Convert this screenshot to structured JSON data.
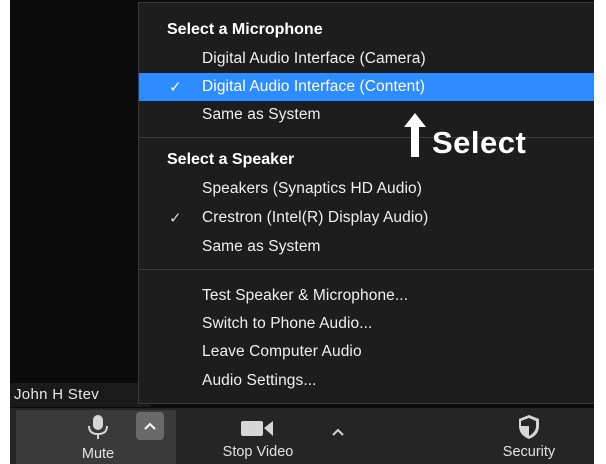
{
  "participant": {
    "name": "John H Stev"
  },
  "menu": {
    "microphone": {
      "title": "Select a Microphone",
      "items": [
        {
          "label": "Digital Audio Interface (Camera)",
          "checked": false,
          "selected": false
        },
        {
          "label": "Digital Audio Interface (Content)",
          "checked": true,
          "selected": true
        },
        {
          "label": "Same as System",
          "checked": false,
          "selected": false
        }
      ]
    },
    "speaker": {
      "title": "Select a Speaker",
      "items": [
        {
          "label": "Speakers (Synaptics HD Audio)",
          "checked": false
        },
        {
          "label": "Crestron (Intel(R) Display Audio)",
          "checked": true
        },
        {
          "label": "Same as System",
          "checked": false
        }
      ]
    },
    "actions": [
      {
        "label": "Test Speaker & Microphone..."
      },
      {
        "label": "Switch to Phone Audio..."
      },
      {
        "label": "Leave Computer Audio"
      },
      {
        "label": "Audio Settings..."
      }
    ],
    "check_glyph": "✓"
  },
  "annotation": {
    "text": "Select"
  },
  "toolbar": {
    "mute_label": "Mute",
    "stop_video_label": "Stop Video",
    "security_label": "Security",
    "icons": {
      "mute": "microphone-icon",
      "mute_caret": "chevron-up-icon",
      "video": "video-camera-icon",
      "video_caret": "chevron-up-icon",
      "security": "shield-icon"
    }
  },
  "colors": {
    "selected_item": "#2d8cff",
    "menu_background": "#1d1d1d",
    "toolbar_background": "#252525"
  }
}
